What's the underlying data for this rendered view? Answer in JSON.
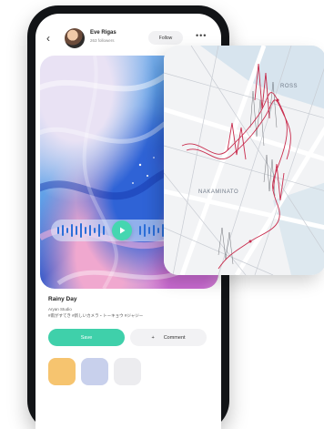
{
  "post": {
    "back_icon": "chevron-left-icon",
    "author_name": "Eve Rigas",
    "author_sub": "263 followers",
    "follow_label": "Follow",
    "more_icon": "more-horizontal-icon"
  },
  "player": {
    "play_icon": "play-icon"
  },
  "track": {
    "title": "Rainy Day",
    "artist": "Aryan Studio",
    "tags": "#雨がすてき #新しいカメラ・トーキョウ #ジャジー",
    "save_label": "Save",
    "comment_icon": "plus-icon",
    "comment_label": "Comment"
  },
  "thumbnails": [
    {
      "color": "#f6c46f"
    },
    {
      "color": "#c8d0ec"
    },
    {
      "color": "#ececef"
    }
  ],
  "map": {
    "label_1": "ROSS",
    "label_2": "NAKAMINATO"
  },
  "colors": {
    "accent": "#3fd0aa",
    "route": "#c92c4d"
  }
}
